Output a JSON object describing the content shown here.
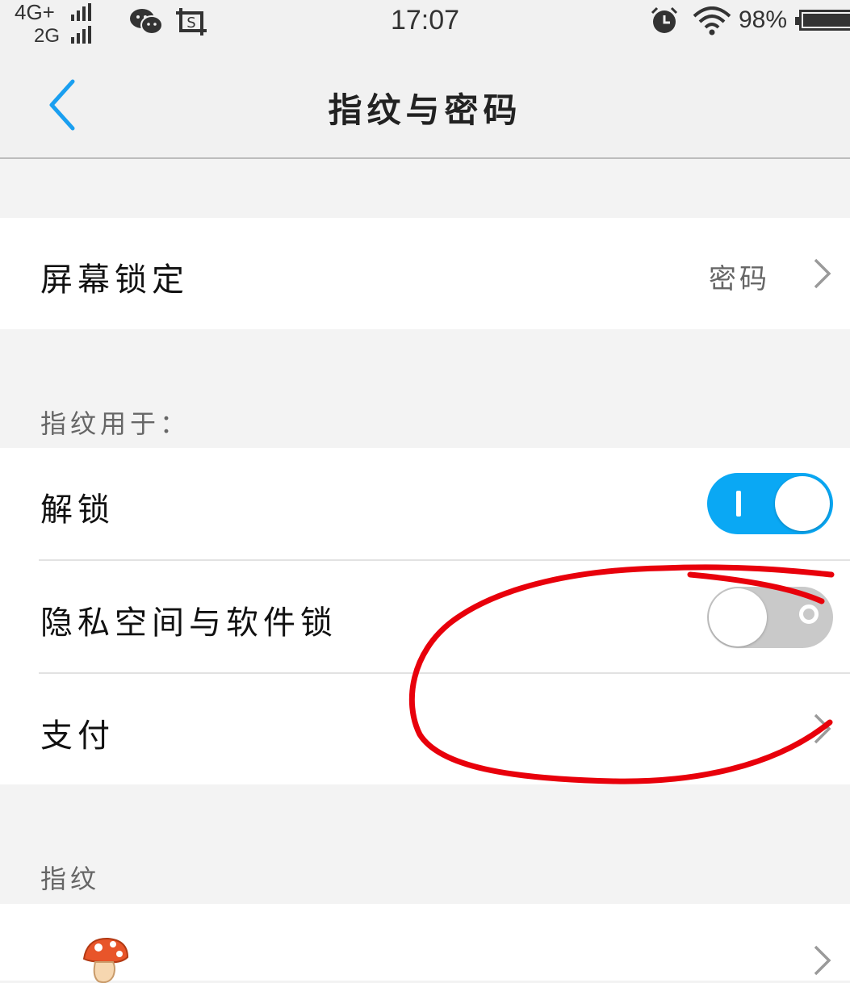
{
  "status_bar": {
    "network_primary": "4G+",
    "network_secondary": "2G",
    "time": "17:07",
    "battery_percent": "98%",
    "icons": [
      "wechat-icon",
      "screenshot-icon",
      "alarm-icon",
      "wifi-icon",
      "battery-icon"
    ]
  },
  "header": {
    "title": "指纹与密码",
    "back_icon": "chevron-left-icon"
  },
  "screen_lock": {
    "label": "屏幕锁定",
    "value": "密码"
  },
  "fingerprint_use": {
    "section_label": "指纹用于：",
    "items": [
      {
        "label": "解锁",
        "control": "toggle",
        "on": true
      },
      {
        "label": "隐私空间与软件锁",
        "control": "toggle",
        "on": false
      },
      {
        "label": "支付",
        "control": "chevron"
      }
    ]
  },
  "fingerprints": {
    "section_label": "指纹",
    "items": [
      {
        "icon": "mushroom-icon",
        "control": "chevron"
      }
    ]
  },
  "colors": {
    "accent": "#0aa8f4",
    "annotation": "#e8000b",
    "toggle_off": "#c9c9c9"
  }
}
